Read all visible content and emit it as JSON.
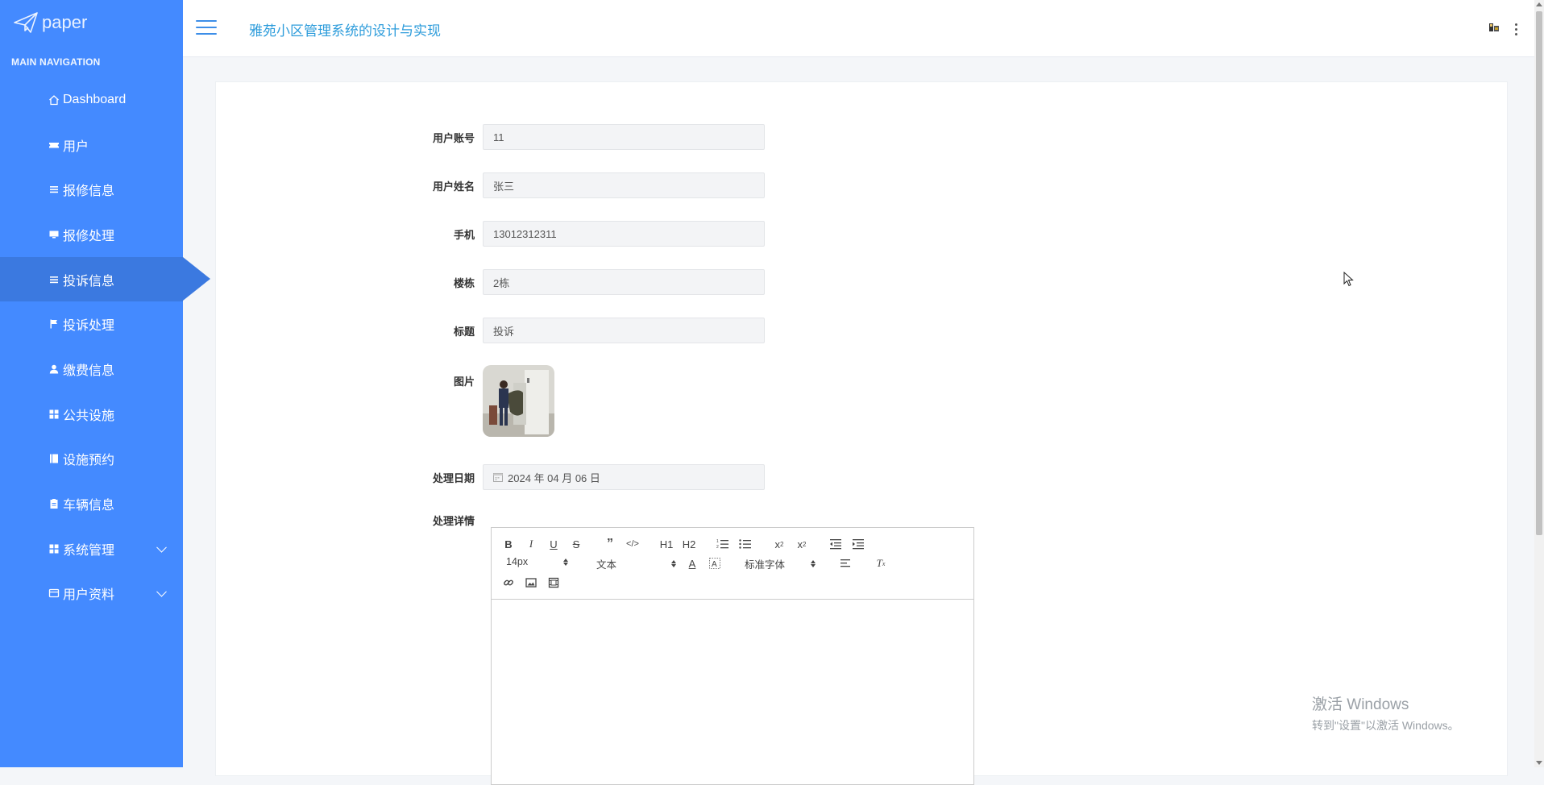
{
  "brand": {
    "logo_text": "paper"
  },
  "sidebar": {
    "heading": "MAIN NAVIGATION",
    "items": [
      {
        "label": "Dashboard",
        "icon": "home-icon"
      },
      {
        "label": "用户",
        "icon": "ticket-icon"
      },
      {
        "label": "报修信息",
        "icon": "list-icon"
      },
      {
        "label": "报修处理",
        "icon": "monitor-icon"
      },
      {
        "label": "投诉信息",
        "icon": "list-icon",
        "active": true
      },
      {
        "label": "投诉处理",
        "icon": "flag-icon"
      },
      {
        "label": "缴费信息",
        "icon": "user-icon"
      },
      {
        "label": "公共设施",
        "icon": "grid-icon"
      },
      {
        "label": "设施预约",
        "icon": "book-icon"
      },
      {
        "label": "车辆信息",
        "icon": "clipboard-icon"
      },
      {
        "label": "系统管理",
        "icon": "grid-icon",
        "expandable": true
      },
      {
        "label": "用户资料",
        "icon": "card-icon",
        "expandable": true
      }
    ]
  },
  "header": {
    "title": "雅苑小区管理系统的设计与实现"
  },
  "form": {
    "account": {
      "label": "用户账号",
      "value": "11"
    },
    "name": {
      "label": "用户姓名",
      "value": "张三"
    },
    "phone": {
      "label": "手机",
      "value": "13012312311"
    },
    "building": {
      "label": "楼栋",
      "value": "2栋"
    },
    "title": {
      "label": "标题",
      "value": "投诉"
    },
    "image": {
      "label": "图片"
    },
    "date": {
      "label": "处理日期",
      "value": "2024 年 04 月 06 日"
    },
    "detail": {
      "label": "处理详情"
    }
  },
  "editor": {
    "size_select": "14px",
    "block_select": "文本",
    "font_select": "标准字体",
    "h1": "H1",
    "h2": "H2"
  },
  "watermark": {
    "line1": "激活 Windows",
    "line2": "转到\"设置\"以激活 Windows。"
  },
  "colors": {
    "sidebar": "#448aff",
    "active": "#3b79e0",
    "title": "#2d9cdb"
  }
}
